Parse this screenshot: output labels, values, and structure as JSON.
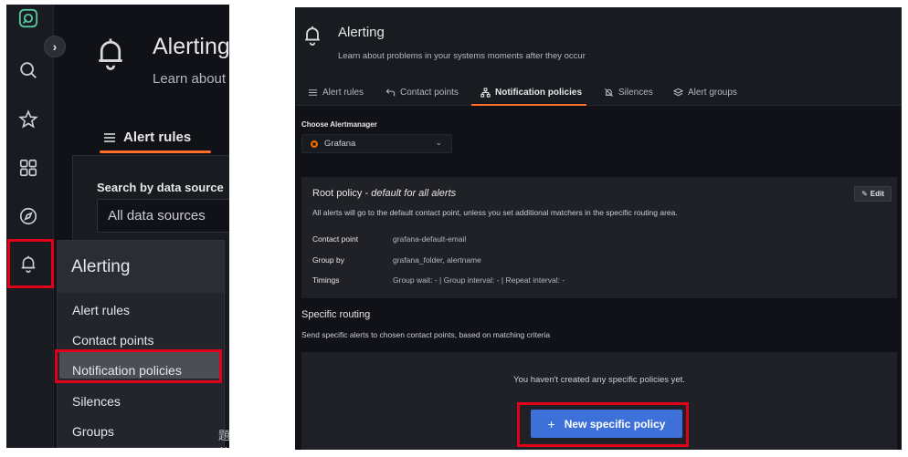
{
  "left_panel": {
    "page_title": "Alerting",
    "page_subtitle": "Learn about",
    "tab_label": "Alert rules",
    "search_label": "Search by data source",
    "search_value": "All data sources",
    "menu": {
      "header": "Alerting",
      "items": [
        "Alert rules",
        "Contact points",
        "Notification policies",
        "Silences",
        "Groups"
      ],
      "active_index": 2
    },
    "cjk_fragment": "題外",
    "nav_icons": [
      "grafana-logo-icon",
      "search-icon",
      "star-icon",
      "dashboards-grid-icon",
      "explore-compass-icon",
      "bell-icon"
    ]
  },
  "right_panel": {
    "title": "Alerting",
    "subtitle": "Learn about problems in your systems moments after they occur",
    "tabs": [
      {
        "label": "Alert rules",
        "icon": "list-icon",
        "active": false
      },
      {
        "label": "Contact points",
        "icon": "comment-arrow-icon",
        "active": false
      },
      {
        "label": "Notification policies",
        "icon": "sitemap-icon",
        "active": true
      },
      {
        "label": "Silences",
        "icon": "bell-slash-icon",
        "active": false
      },
      {
        "label": "Alert groups",
        "icon": "layer-group-icon",
        "active": false
      }
    ],
    "alertmanager": {
      "label": "Choose Alertmanager",
      "value": "Grafana"
    },
    "root_policy": {
      "title": "Root policy",
      "title_suffix": "default for all alerts",
      "edit_label": "Edit",
      "description": "All alerts will go to the default contact point, unless you set additional matchers in the specific routing area.",
      "rows": [
        {
          "key": "Contact point",
          "value": "grafana-default-email"
        },
        {
          "key": "Group by",
          "value": "grafana_folder, alertname"
        },
        {
          "key": "Timings",
          "value": "Group wait: - | Group interval: - | Repeat interval: -"
        }
      ]
    },
    "specific_routing": {
      "title": "Specific routing",
      "description": "Send specific alerts to chosen contact points, based on matching criteria",
      "empty_text": "You haven't created any specific policies yet.",
      "new_button_label": "New specific policy",
      "new_button_icon": "+"
    }
  },
  "colors": {
    "background": "#111217",
    "panel": "#181b1f",
    "accent_orange": "#ff6e26",
    "primary_blue": "#3d71d9",
    "highlight_red": "#e0001a"
  }
}
